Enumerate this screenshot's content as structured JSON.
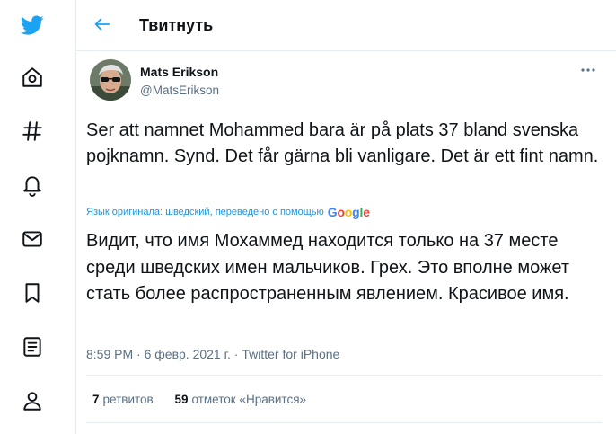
{
  "header": {
    "title": "Твитнуть"
  },
  "tweet": {
    "author_name": "Mats Erikson",
    "author_handle": "@MatsErikson",
    "original_text": "Ser att namnet Mohammed bara är på plats 37 bland svenska pojknamn. Synd. Det får gärna bli vanligare. Det är ett fint namn.",
    "translation_note": "Язык оригинала: шведский, переведено с помощью",
    "translation_brand": "Google",
    "translated_text": "Видит, что имя Мохаммед находится только на 37 месте среди шведских имен мальчиков. Грех. Это вполне может стать более распространенным явлением. Красивое имя.",
    "time": "8:59 PM",
    "date": "6 февр. 2021 г.",
    "separator": "·",
    "source": "Twitter for iPhone",
    "retweets_count": "7",
    "retweets_label": "ретвитов",
    "likes_count": "59",
    "likes_label": "отметок «Нравится»"
  },
  "colors": {
    "accent": "#1da1f2",
    "text": "#0f1419",
    "secondary": "#5b7083",
    "border": "#e6ecf0"
  },
  "icons": [
    "twitter-logo-icon",
    "home-icon",
    "explore-hashtag-icon",
    "notifications-bell-icon",
    "messages-envelope-icon",
    "bookmarks-icon",
    "lists-icon",
    "profile-icon",
    "back-arrow-icon",
    "more-dots-icon"
  ]
}
